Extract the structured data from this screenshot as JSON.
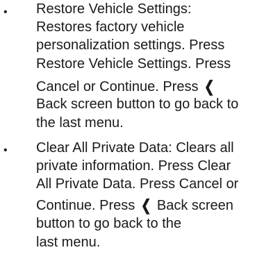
{
  "items": [
    {
      "bullet": "•",
      "lines": [
        {
          "text": "Restore Vehicle Settings:"
        },
        {
          "text": "Restores factory vehicle"
        },
        {
          "text": "personalization settings. Press"
        },
        {
          "text": "Restore Vehicle Settings. Press"
        },
        {
          "before": "Cancel or Continue. Press",
          "glyph": "❮",
          "after": ""
        },
        {
          "text": "Back screen button to go back to"
        },
        {
          "text": "the last menu."
        }
      ]
    },
    {
      "bullet": "•",
      "lines": [
        {
          "text": "Clear All Private Data: Clears all"
        },
        {
          "text": "private information. Press Clear"
        },
        {
          "text": "All Private Data. Press Cancel or"
        },
        {
          "before": "Continue. Press",
          "glyph": "❮",
          "after": "Back screen"
        },
        {
          "text": "button to go back to the"
        },
        {
          "text": "last menu."
        }
      ]
    }
  ]
}
